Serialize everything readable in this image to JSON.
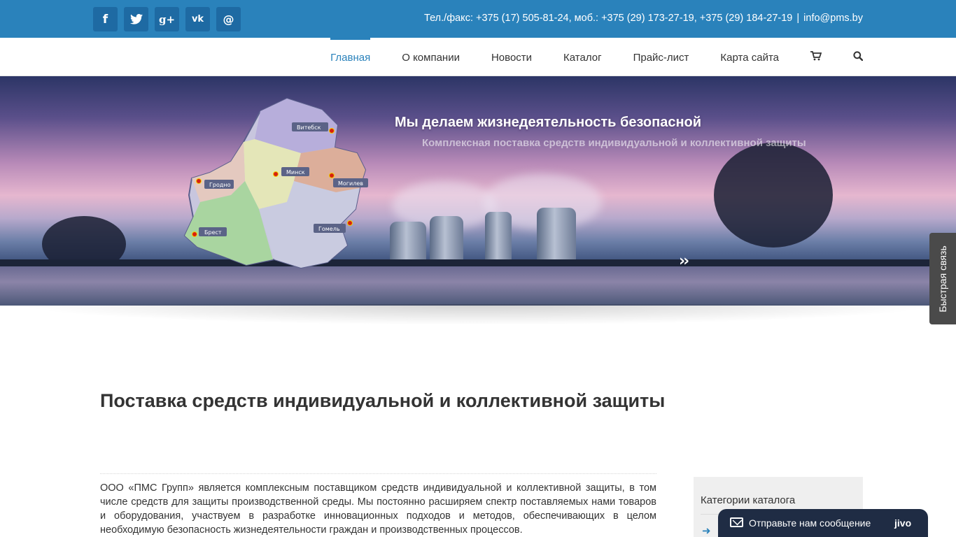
{
  "topbar": {
    "social": [
      {
        "name": "facebook",
        "glyph": "f"
      },
      {
        "name": "twitter",
        "glyph": "🐦"
      },
      {
        "name": "google-plus",
        "glyph": "g+"
      },
      {
        "name": "vk",
        "glyph": "vk"
      },
      {
        "name": "email",
        "glyph": "@"
      }
    ],
    "phones_label": "Тел./факс: +375 (17) 505-81-24, моб.: +375 (29) 173-27-19, +375 (29) 184-27-19",
    "separator": "|",
    "email": "info@pms.by"
  },
  "nav": {
    "items": [
      "Главная",
      "О компании",
      "Новости",
      "Каталог",
      "Прайс-лист",
      "Карта сайта"
    ],
    "active": "Главная",
    "cart_icon": "🛒",
    "search_icon": "🔍"
  },
  "hero": {
    "title": "Мы делаем жизнедеятельность безопасной",
    "subtitle": "Комплексная поставка средств индивидуальной и коллективной защиты",
    "next_arrow": "››",
    "map_cities": [
      "Витебск",
      "Гродно",
      "Минск",
      "Могилев",
      "Брест",
      "Гомель"
    ]
  },
  "quick_contact": "Быстрая связь",
  "main": {
    "title": "Поставка средств индивидуальной и коллективной защиты",
    "intro": "ООО «ПМС Групп» является комплексным поставщиком средств индивидуальной и коллективной защиты, в том числе средств для защиты производственной среды. Мы  постоянно расширяем спектр поставляемых нами товаров и оборудования, участвуем в разработке инновационных подходов и методов, обеспечивающих в целом необходимую безопасность жизнедеятельности граждан и производственных процессов."
  },
  "sidebar": {
    "title": "Категории каталога",
    "arrow": "➜"
  },
  "chat": {
    "label": "Отправьте нам сообщение",
    "brand": "jivo"
  },
  "colors": {
    "brand_blue": "#2a82bb",
    "dark": "#1f2c44"
  }
}
